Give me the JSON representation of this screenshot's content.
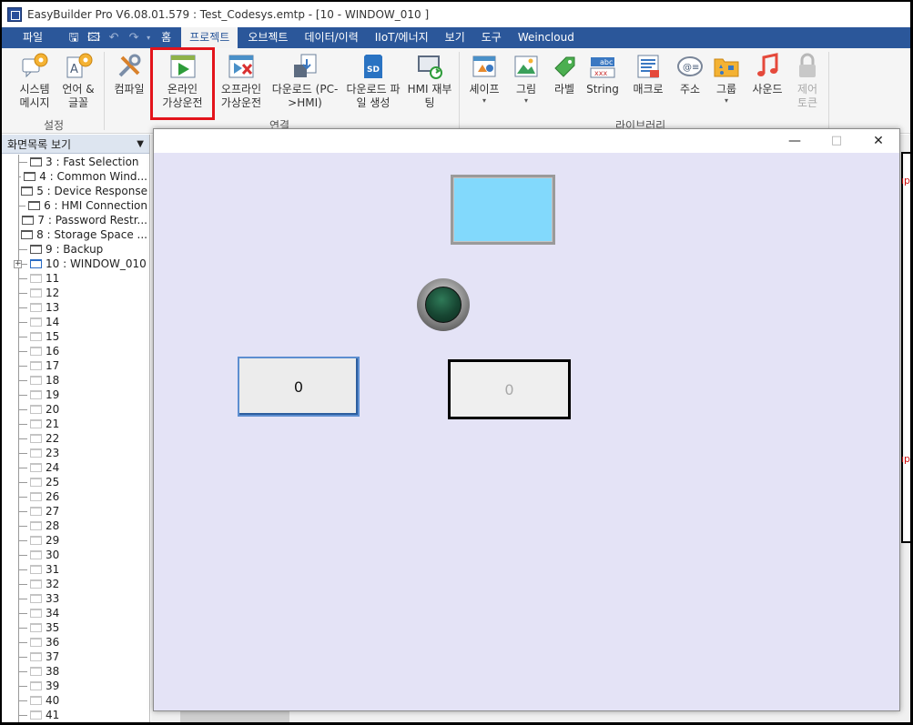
{
  "window": {
    "title": "EasyBuilder Pro V6.08.01.579 : Test_Codesys.emtp - [10 - WINDOW_010 ]"
  },
  "menubar": {
    "file": "파일",
    "home": "홈",
    "items": [
      "프로젝트",
      "오브젝트",
      "데이터/이력",
      "IIoT/에너지",
      "보기",
      "도구",
      "Weincloud"
    ],
    "active": "프로젝트"
  },
  "ribbon": {
    "buttons": {
      "system_message": "시스템\n메시지",
      "language_font": "언어 &\n글꼴",
      "compile": "컴파일",
      "online_sim": "온라인\n가상운전",
      "offline_sim": "오프라인\n가상운전",
      "download_pc": "다운로드 (PC-\n>HMI)",
      "download_file": "다운로드 파\n일 생성",
      "hmi_reboot": "HMI 재부\n팅",
      "shape": "셰이프",
      "picture": "그림",
      "label": "라벨",
      "string": "String",
      "macro": "매크로",
      "address": "주소",
      "group": "그룹",
      "sound": "사운드",
      "control_token": "제어\n토큰"
    },
    "groups": {
      "settings": "설정",
      "connection": "연결",
      "library": "라이브러리"
    },
    "colors": {
      "highlight": "#e3141b",
      "menubar": "#2b579a"
    }
  },
  "left_panel": {
    "header": "화면목록 보기",
    "items": [
      "3 : Fast Selection",
      "4 : Common Wind...",
      "5 : Device Response",
      "6 : HMI Connection",
      "7 : Password Restr...",
      "8 : Storage Space ...",
      "9 : Backup",
      "10 : WINDOW_010",
      "11",
      "12",
      "13",
      "14",
      "15",
      "16",
      "17",
      "18",
      "19",
      "20",
      "21",
      "22",
      "23",
      "24",
      "25",
      "26",
      "27",
      "28",
      "29",
      "30",
      "31",
      "32",
      "33",
      "34",
      "35",
      "36",
      "37",
      "38",
      "39",
      "40",
      "41"
    ]
  },
  "simulator": {
    "numeric_input_value": "0",
    "numeric_display_value": "0",
    "lamp_state": "off",
    "rect_color": "#82d9fc"
  }
}
